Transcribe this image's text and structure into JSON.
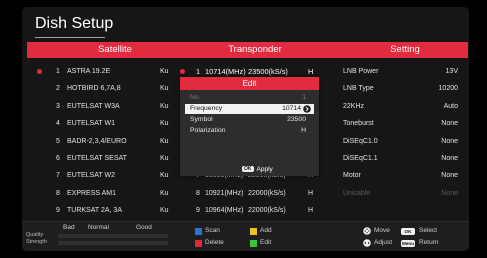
{
  "screen": {
    "title": "Dish Setup"
  },
  "colors": {
    "accent": "#e22b3f"
  },
  "header": {
    "satellite": "Satellite",
    "transponder": "Transponder",
    "setting": "Setting"
  },
  "satellites": [
    {
      "no": "1",
      "name": "ASTRA 19.2E",
      "band": "Ku"
    },
    {
      "no": "2",
      "name": "HOTBIRD 6,7A,8",
      "band": "Ku"
    },
    {
      "no": "3",
      "name": "EUTELSAT W3A",
      "band": "Ku"
    },
    {
      "no": "4",
      "name": "EUTELSAT W1",
      "band": "Ku"
    },
    {
      "no": "5",
      "name": "BADR-2,3,4/EURO",
      "band": "Ku"
    },
    {
      "no": "6",
      "name": "EUTELSAT SESAT",
      "band": "Ku"
    },
    {
      "no": "7",
      "name": "EUTELSAT W2",
      "band": "Ku"
    },
    {
      "no": "8",
      "name": "EXPRESS AM1",
      "band": "Ku"
    },
    {
      "no": "9",
      "name": "TURKSAT 2A, 3A",
      "band": "Ku"
    }
  ],
  "transponders": [
    {
      "no": "1",
      "frequency": "10714(MHz)",
      "symbol_rate": "23500(kS/s)",
      "polarization": "H"
    },
    {
      "no": "7",
      "frequency": "10853(MHz)",
      "symbol_rate": "22000(kS/s)",
      "polarization": "H"
    },
    {
      "no": "8",
      "frequency": "10921(MHz)",
      "symbol_rate": "22000(kS/s)",
      "polarization": "H"
    },
    {
      "no": "9",
      "frequency": "10964(MHz)",
      "symbol_rate": "22000(kS/s)",
      "polarization": "H"
    }
  ],
  "settings": [
    {
      "label": "LNB Power",
      "value": "13V"
    },
    {
      "label": "LNB Type",
      "value": "10200"
    },
    {
      "label": "22KHz",
      "value": "Auto"
    },
    {
      "label": "Toneburst",
      "value": "None"
    },
    {
      "label": "DiSEqC1.0",
      "value": "None"
    },
    {
      "label": "DiSEqC1.1",
      "value": "None"
    },
    {
      "label": "Motor",
      "value": "None"
    },
    {
      "label": "Unicable",
      "value": "None"
    }
  ],
  "edit_dialog": {
    "title": "Edit",
    "fields": [
      {
        "label": "No.",
        "value": "1"
      },
      {
        "label": "Frequency",
        "value": "10714"
      },
      {
        "label": "Symbol",
        "value": "23500"
      },
      {
        "label": "Polarization",
        "value": "H"
      }
    ],
    "apply_key": "OK",
    "apply_label": "Apply"
  },
  "signal": {
    "scale": [
      "Bad",
      "Normal",
      "Good"
    ],
    "quality_label": "Quality",
    "strength_label": "Strength",
    "quality_percent": 0,
    "strength_percent": 0
  },
  "color_keys": [
    {
      "label": "Scan",
      "color": "#2f6fd6"
    },
    {
      "label": "Add",
      "color": "#e8c220"
    },
    {
      "label": "Delete",
      "color": "#e02a3a"
    },
    {
      "label": "Edit",
      "color": "#3cc43c"
    }
  ],
  "nav_hints": [
    {
      "icon": "dpad-move-icon",
      "label": "Move"
    },
    {
      "icon": "dpad-adjust-icon",
      "label": "Adjust"
    },
    {
      "key": "OK",
      "label": "Select"
    },
    {
      "key": "Menu",
      "label": "Return"
    }
  ]
}
